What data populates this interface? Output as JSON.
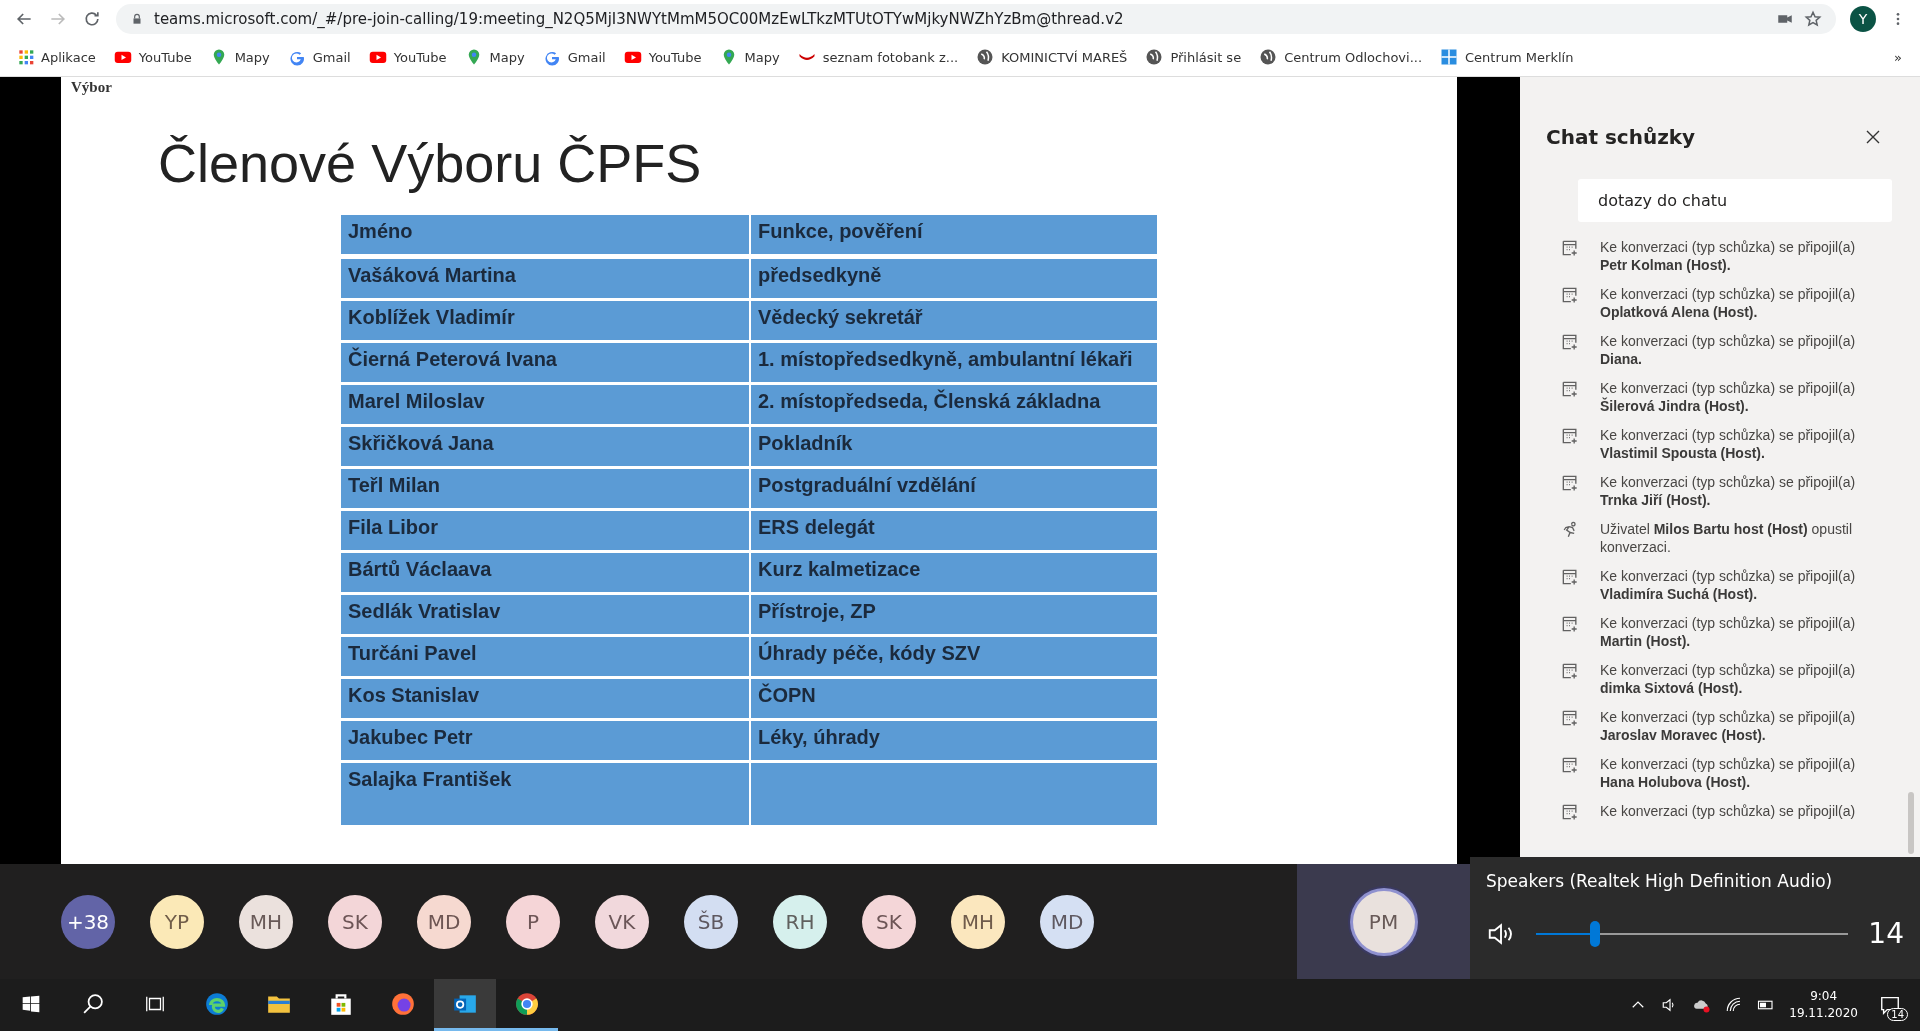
{
  "browser": {
    "url": "teams.microsoft.com/_#/pre-join-calling/19:meeting_N2Q5MjI3NWYtMmM5OC00MzEwLTkzMTUtOTYwMjkyNWZhYzBm@thread.v2",
    "profile": "Y",
    "bookmarks": [
      {
        "kind": "apps",
        "label": "Aplikace"
      },
      {
        "kind": "youtube",
        "label": "YouTube"
      },
      {
        "kind": "maps",
        "label": "Mapy"
      },
      {
        "kind": "gmail",
        "label": "Gmail"
      },
      {
        "kind": "youtube",
        "label": "YouTube"
      },
      {
        "kind": "maps",
        "label": "Mapy"
      },
      {
        "kind": "gmail",
        "label": "Gmail"
      },
      {
        "kind": "youtube",
        "label": "YouTube"
      },
      {
        "kind": "maps",
        "label": "Mapy"
      },
      {
        "kind": "seznam",
        "label": "seznam fotobank z..."
      },
      {
        "kind": "globe",
        "label": "KOMINICTVÍ MAREŠ"
      },
      {
        "kind": "globe",
        "label": "Přihlásit se"
      },
      {
        "kind": "globe",
        "label": "Centrum Odlochovi..."
      },
      {
        "kind": "grid",
        "label": "Centrum Merklín"
      }
    ],
    "more": "»"
  },
  "slide": {
    "section": "Výbor",
    "title": "Členové Výboru ČPFS",
    "rows": [
      [
        "Jméno",
        "Funkce, pověření"
      ],
      [
        "Vašáková Martina",
        "předsedkyně"
      ],
      [
        "Koblížek Vladimír",
        "Vědecký sekretář"
      ],
      [
        "Čierná Peterová Ivana",
        "1. místopředsedkyně, ambulantní lékaři"
      ],
      [
        "Marel Miloslav",
        "2. místopředseda, Členská základna"
      ],
      [
        "Skřičková Jana",
        "Pokladník"
      ],
      [
        "Teřl Milan",
        "Postgraduální vzdělání"
      ],
      [
        "Fila Libor",
        "ERS delegát"
      ],
      [
        "Bártů Václaava",
        "Kurz kalmetizace"
      ],
      [
        "Sedlák Vratislav",
        "Přístroje, ZP"
      ],
      [
        "Turčáni Pavel",
        "Úhrady péče, kódy SZV"
      ],
      [
        "Kos Stanislav",
        "ČOPN"
      ],
      [
        "Jakubec Petr",
        "Léky, úhrady"
      ],
      [
        "Salajka František",
        ""
      ]
    ]
  },
  "chat": {
    "title": "Chat schůzky",
    "subject": "dotazy do chatu",
    "messages": [
      {
        "kind": "join",
        "text": "Ke konverzaci (typ schůzka) se připojil(a) **Petr Kolman (Host).**"
      },
      {
        "kind": "join",
        "text": "Ke konverzaci (typ schůzka) se připojil(a) **Oplatková Alena (Host).**"
      },
      {
        "kind": "join",
        "text": "Ke konverzaci (typ schůzka) se připojil(a) **Diana.**"
      },
      {
        "kind": "join",
        "text": "Ke konverzaci (typ schůzka) se připojil(a) **Šilerová Jindra (Host).**"
      },
      {
        "kind": "join",
        "text": "Ke konverzaci (typ schůzka) se připojil(a) **Vlastimil Spousta (Host).**"
      },
      {
        "kind": "join",
        "text": "Ke konverzaci (typ schůzka) se připojil(a) **Trnka Jiří (Host).**"
      },
      {
        "kind": "leave",
        "text": "Uživatel **Milos Bartu host (Host)** opustil konverzaci."
      },
      {
        "kind": "join",
        "text": "Ke konverzaci (typ schůzka) se připojil(a) **Vladimíra Suchá (Host).**"
      },
      {
        "kind": "join",
        "text": "Ke konverzaci (typ schůzka) se připojil(a) **Martin (Host).**"
      },
      {
        "kind": "join",
        "text": "Ke konverzaci (typ schůzka) se připojil(a) **dimka Sixtová (Host).**"
      },
      {
        "kind": "join",
        "text": "Ke konverzaci (typ schůzka) se připojil(a) **Jaroslav Moravec (Host).**"
      },
      {
        "kind": "join",
        "text": "Ke konverzaci (typ schůzka) se připojil(a) **Hana Holubova (Host).**"
      },
      {
        "kind": "join",
        "text": "Ke konverzaci (typ schůzka) se připojil(a)"
      }
    ]
  },
  "participants": [
    {
      "initials": "+38",
      "color": "#6264a7",
      "selected": false
    },
    {
      "initials": "YP",
      "color": "#fbe9b7",
      "selected": false
    },
    {
      "initials": "MH",
      "color": "#ebe1dd",
      "selected": false
    },
    {
      "initials": "SK",
      "color": "#f3d6d8",
      "selected": false
    },
    {
      "initials": "MD",
      "color": "#f6d9d0",
      "selected": false
    },
    {
      "initials": "P",
      "color": "#f5d5d7",
      "selected": false
    },
    {
      "initials": "VK",
      "color": "#f1d8dc",
      "selected": false
    },
    {
      "initials": "ŠB",
      "color": "#d3def2",
      "selected": false
    },
    {
      "initials": "RH",
      "color": "#d6f0ed",
      "selected": false
    },
    {
      "initials": "SK",
      "color": "#f4d6d8",
      "selected": false
    },
    {
      "initials": "MH",
      "color": "#fbe7be",
      "selected": false
    },
    {
      "initials": "MD",
      "color": "#d5e0f3",
      "selected": false
    },
    {
      "initials": "PM",
      "color": "#e9e1dd",
      "selected": true
    }
  ],
  "volume": {
    "device": "Speakers (Realtek High Definition Audio)",
    "level": 0.19,
    "reading": "14"
  },
  "taskbar": {
    "apps": [
      {
        "kind": "edge",
        "running": false
      },
      {
        "kind": "explorer",
        "running": false
      },
      {
        "kind": "store",
        "running": false
      },
      {
        "kind": "firefox",
        "running": false
      },
      {
        "kind": "outlook",
        "running": true
      },
      {
        "kind": "chrome",
        "running": true
      }
    ],
    "time": "9:04",
    "date": "19.11.2020",
    "notifications": "14"
  }
}
